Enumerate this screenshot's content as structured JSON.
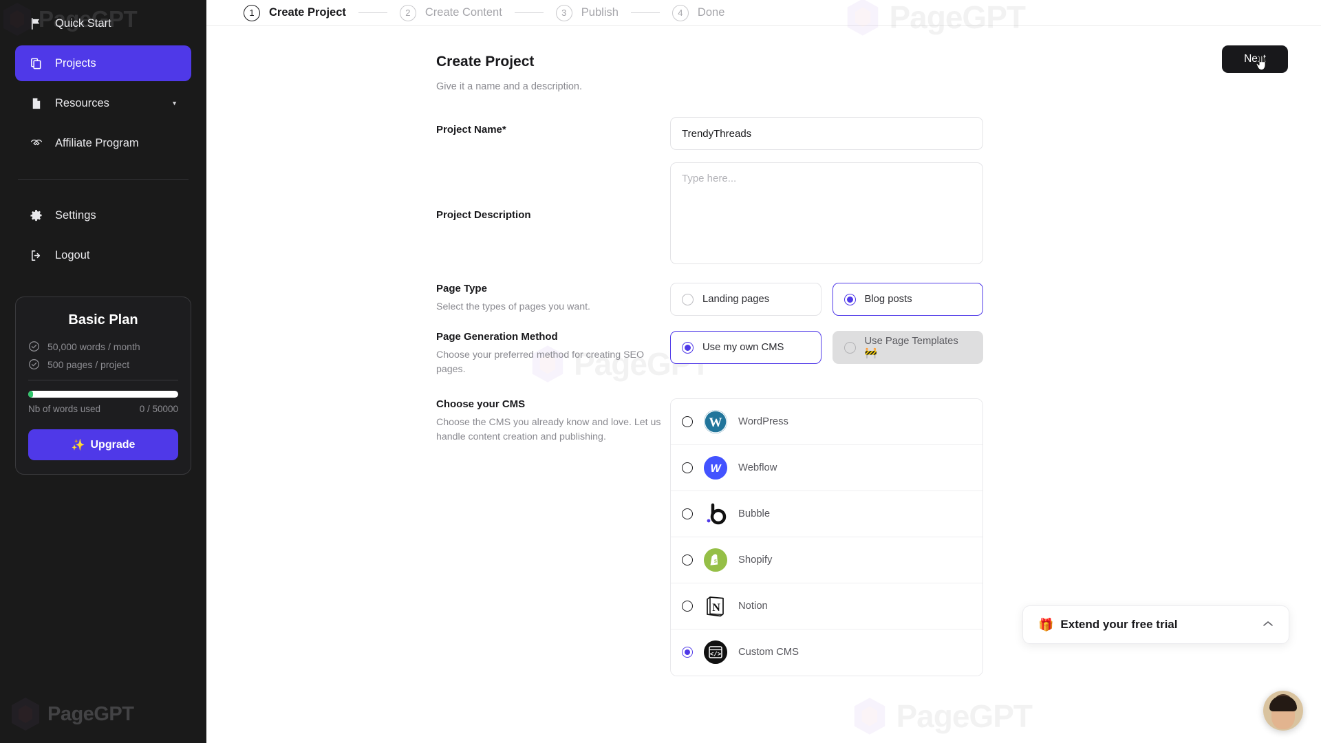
{
  "brand": {
    "name": "PageGPT"
  },
  "sidebar": {
    "items": [
      {
        "label": "Quick Start",
        "icon": "flag-icon",
        "active": false
      },
      {
        "label": "Projects",
        "icon": "documents-icon",
        "active": true
      },
      {
        "label": "Resources",
        "icon": "document-icon",
        "active": false,
        "chevron": "▼"
      },
      {
        "label": "Affiliate Program",
        "icon": "handshake-icon",
        "active": false
      }
    ],
    "lower_items": [
      {
        "label": "Settings",
        "icon": "gear-icon"
      },
      {
        "label": "Logout",
        "icon": "logout-icon"
      }
    ],
    "plan": {
      "title": "Basic Plan",
      "features": [
        "50,000 words / month",
        "500 pages / project"
      ],
      "usage_label": "Nb of words used",
      "usage_value": "0 / 50000",
      "usage_percent": 3,
      "upgrade_label": "Upgrade",
      "upgrade_icon": "✨"
    }
  },
  "stepper": {
    "steps": [
      {
        "num": "1",
        "label": "Create Project",
        "active": true
      },
      {
        "num": "2",
        "label": "Create Content",
        "active": false
      },
      {
        "num": "3",
        "label": "Publish",
        "active": false
      },
      {
        "num": "4",
        "label": "Done",
        "active": false
      }
    ]
  },
  "header": {
    "title": "Create Project",
    "subtitle": "Give it a name and a description.",
    "next_label": "Next"
  },
  "form": {
    "project_name": {
      "label": "Project Name*",
      "value": "TrendyThreads",
      "placeholder": ""
    },
    "project_description": {
      "label": "Project Description",
      "value": "",
      "placeholder": "Type here..."
    },
    "page_type": {
      "label": "Page Type",
      "desc": "Select the types of pages you want.",
      "options": [
        {
          "label": "Landing pages",
          "selected": false,
          "disabled": false
        },
        {
          "label": "Blog posts",
          "selected": true,
          "disabled": false
        }
      ]
    },
    "generation_method": {
      "label": "Page Generation Method",
      "desc": "Choose your preferred method for creating SEO pages.",
      "options": [
        {
          "label": "Use my own CMS",
          "selected": true,
          "disabled": false
        },
        {
          "label": "Use Page Templates 🚧",
          "selected": false,
          "disabled": true
        }
      ]
    },
    "cms": {
      "label": "Choose your CMS",
      "desc": "Choose the CMS you already know and love. Let us handle content creation and publishing.",
      "options": [
        {
          "label": "WordPress",
          "logo": "wordpress-logo",
          "selected": false
        },
        {
          "label": "Webflow",
          "logo": "webflow-logo",
          "selected": false
        },
        {
          "label": "Bubble",
          "logo": "bubble-logo",
          "selected": false
        },
        {
          "label": "Shopify",
          "logo": "shopify-logo",
          "selected": false
        },
        {
          "label": "Notion",
          "logo": "notion-logo",
          "selected": false
        },
        {
          "label": "Custom CMS",
          "logo": "custom-cms-logo",
          "selected": true
        }
      ]
    }
  },
  "trial_widget": {
    "icon": "🎁",
    "label": "Extend your free trial",
    "chevron": "⌃"
  },
  "colors": {
    "accent": "#4f39e8",
    "sidebar_bg": "#1a1a1a",
    "dark_button": "#18181b",
    "progress": "#2fc46b"
  }
}
